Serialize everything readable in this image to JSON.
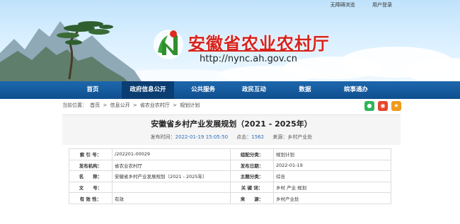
{
  "top_links": {
    "accessibility": "无障碍浏览",
    "login": "用户登录"
  },
  "site": {
    "title": "安徽省农业农村厅",
    "url": "http://nync.ah.gov.cn"
  },
  "nav": [
    {
      "label": "首页",
      "active": false
    },
    {
      "label": "政府信息公开",
      "active": true
    },
    {
      "label": "公共服务",
      "active": false
    },
    {
      "label": "政民互动",
      "active": false
    },
    {
      "label": "数据",
      "active": false
    },
    {
      "label": "皖事通办",
      "active": false
    }
  ],
  "breadcrumb": {
    "label": "当前位置：",
    "items": [
      "首页",
      "信息公开",
      "省农业农村厅",
      "规划计划"
    ]
  },
  "share": {
    "wechat_icon": "wechat-icon",
    "weibo_icon": "weibo-icon",
    "favorite_icon": "star-icon"
  },
  "article": {
    "title": "安徽省乡村产业发展规划（2021 - 2025年）",
    "publish_label": "发布时间：",
    "publish_time": "2022-01-19 15:05:50",
    "views_label": "点击：",
    "views": "1562",
    "source_label": "来源：",
    "source": "乡村产业处"
  },
  "info": {
    "index_no": {
      "label": "索 引 号：",
      "value": "/202201-00029"
    },
    "category": {
      "label": "组配分类：",
      "value": "规划计划"
    },
    "publisher": {
      "label": "发布机构：",
      "value": "省农业农村厅"
    },
    "date": {
      "label": "发布日期：",
      "value": "2022-01-19"
    },
    "name": {
      "label": "名　　称：",
      "value": "安徽省乡村产业发展规划（2021 - 2025年）"
    },
    "topic": {
      "label": "主题分类：",
      "value": "综合"
    },
    "doc_no": {
      "label": "文　　号：",
      "value": ""
    },
    "keywords": {
      "label": "关 键 词：",
      "value": "乡村 产业 规划"
    },
    "validity": {
      "label": "有 效 性：",
      "value": "有效"
    },
    "origin": {
      "label": "来　　源：",
      "value": "乡村产业处"
    }
  },
  "colors": {
    "brand_red": "#d8231d",
    "nav_blue": "#1d67ad",
    "nav_active": "#0a3d72",
    "link_blue": "#2a6db8"
  }
}
